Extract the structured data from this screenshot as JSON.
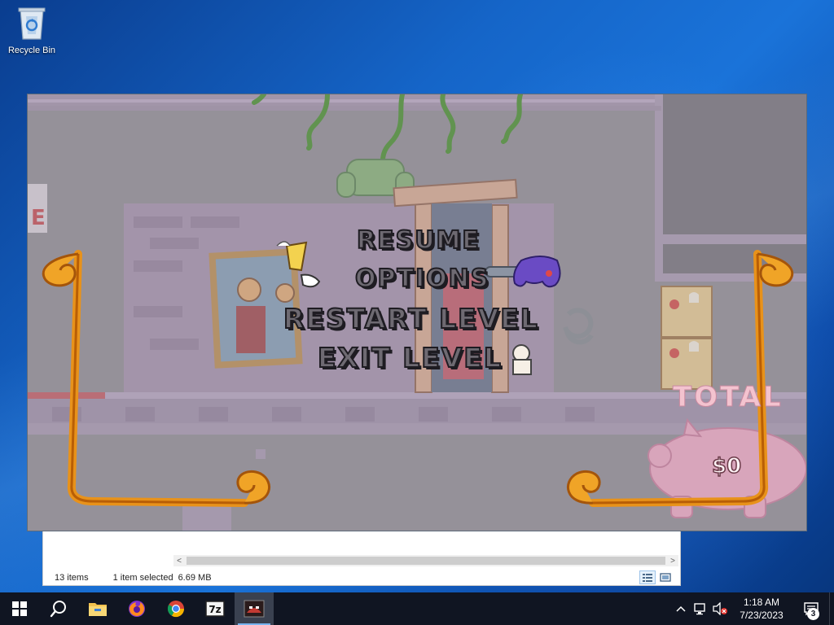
{
  "desktop": {
    "icons": [
      {
        "label": "Recycle Bin",
        "icon": "recycle-bin-icon"
      }
    ]
  },
  "explorer": {
    "status_items": "13 items",
    "status_selected": "1 item selected",
    "status_size": "6.69 MB",
    "scroll_left": "<",
    "scroll_right": ">"
  },
  "game": {
    "menu": {
      "resume": "RESUME",
      "options": "OPTIONS",
      "restart": "RESTART LEVEL",
      "exit": "EXIT LEVEL"
    },
    "hud": {
      "total_label": "TOTAL",
      "money": "$0"
    }
  },
  "taskbar": {
    "apps": [
      {
        "name": "start",
        "icon": "windows-logo-icon"
      },
      {
        "name": "search",
        "icon": "search-icon"
      },
      {
        "name": "file-explorer",
        "icon": "folder-icon"
      },
      {
        "name": "firefox",
        "icon": "firefox-icon"
      },
      {
        "name": "chrome",
        "icon": "chrome-icon"
      },
      {
        "name": "7zip",
        "icon": "7zip-icon",
        "text": "7z"
      },
      {
        "name": "pizza-tower",
        "icon": "pizza-tower-icon"
      }
    ],
    "clock": {
      "time": "1:18 AM",
      "date": "7/23/2023"
    },
    "notifications_count": "3"
  },
  "colors": {
    "taskbar": "#101522",
    "game_overlay": "#8d8991",
    "menu_text": "#6e6a72",
    "frame_orange": "#e8921a",
    "pig_pink": "#f2a6c4"
  }
}
